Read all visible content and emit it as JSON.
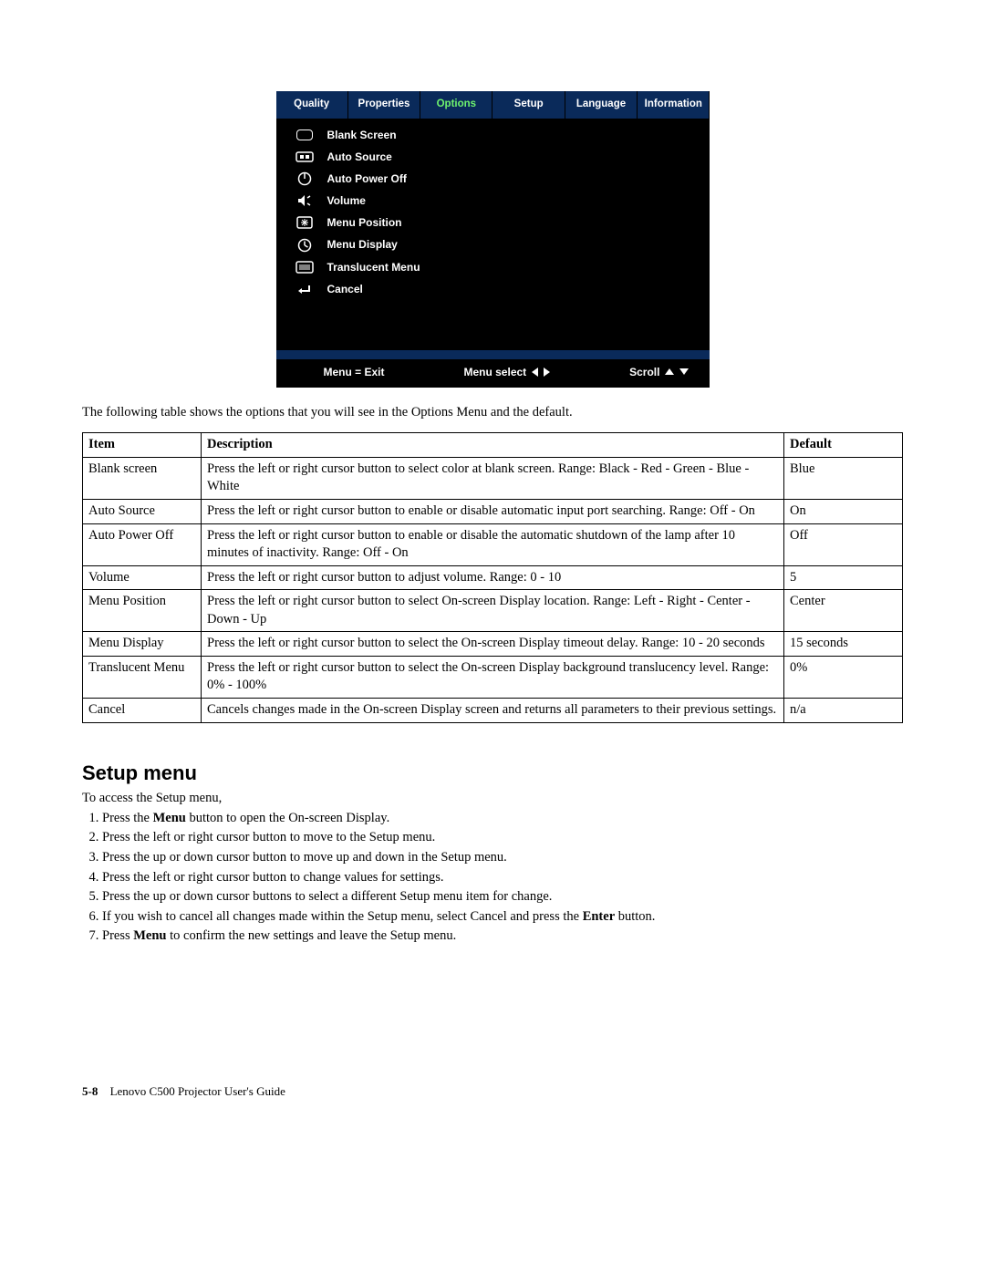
{
  "osd": {
    "tabs": [
      "Quality",
      "Properties",
      "Options",
      "Setup",
      "Language",
      "Information"
    ],
    "active_tab_index": 2,
    "items": [
      "Blank Screen",
      "Auto Source",
      "Auto Power Off",
      "Volume",
      "Menu Position",
      "Menu Display",
      "Translucent Menu",
      "Cancel"
    ],
    "footer": {
      "menu_exit": "Menu = Exit",
      "menu_select": "Menu select",
      "scroll": "Scroll"
    }
  },
  "intro_paragraph": "The following table shows the options that you will see in the Options Menu and the default.",
  "table": {
    "headers": {
      "item": "Item",
      "description": "Description",
      "default": "Default"
    },
    "rows": [
      {
        "item": "Blank screen",
        "description": "Press the left or right cursor button to select color at blank screen. Range: Black - Red - Green - Blue - White",
        "default": "Blue"
      },
      {
        "item": "Auto Source",
        "description": "Press the left or right cursor button to enable or disable automatic input port searching. Range: Off - On",
        "default": "On"
      },
      {
        "item": "Auto Power Off",
        "description": "Press the left or right cursor button to enable or disable the automatic shutdown of the lamp after 10 minutes of inactivity. Range: Off - On",
        "default": "Off"
      },
      {
        "item": "Volume",
        "description": "Press the left or right cursor button to adjust volume. Range: 0 - 10",
        "default": "5"
      },
      {
        "item": "Menu Position",
        "description": "Press the left or right cursor button to select On-screen Display location. Range: Left - Right - Center - Down - Up",
        "default": "Center"
      },
      {
        "item": "Menu Display",
        "description": "Press the left or right cursor button to select the On-screen Display timeout delay. Range: 10 - 20 seconds",
        "default": "15 seconds"
      },
      {
        "item": "Translucent Menu",
        "description": "Press the left or right cursor button to select the On-screen Display background translucency level. Range: 0% - 100%",
        "default": "0%"
      },
      {
        "item": "Cancel",
        "description": "Cancels changes made in the On-screen Display screen and returns all parameters to their previous settings.",
        "default": "n/a"
      }
    ]
  },
  "setup": {
    "heading": "Setup menu",
    "intro": "To access the Setup menu,",
    "steps": [
      {
        "pre": "Press the ",
        "bold": "Menu",
        "post": " button to open the On-screen Display."
      },
      {
        "pre": "Press the left or right cursor button to move to the Setup menu.",
        "bold": "",
        "post": ""
      },
      {
        "pre": "Press the up or down cursor button to move up and down in the Setup menu.",
        "bold": "",
        "post": ""
      },
      {
        "pre": "Press the left or right cursor button to change values for settings.",
        "bold": "",
        "post": ""
      },
      {
        "pre": "Press the up or down cursor buttons to select a different Setup menu item for change.",
        "bold": "",
        "post": ""
      },
      {
        "pre": "If you wish to cancel all changes made within the Setup menu, select Cancel and press the ",
        "bold": "Enter",
        "post": " button."
      },
      {
        "pre": "Press ",
        "bold": "Menu",
        "post": " to confirm the new settings and leave the Setup menu."
      }
    ]
  },
  "page_footer": {
    "page": "5-8",
    "title": "Lenovo C500 Projector User's Guide"
  }
}
